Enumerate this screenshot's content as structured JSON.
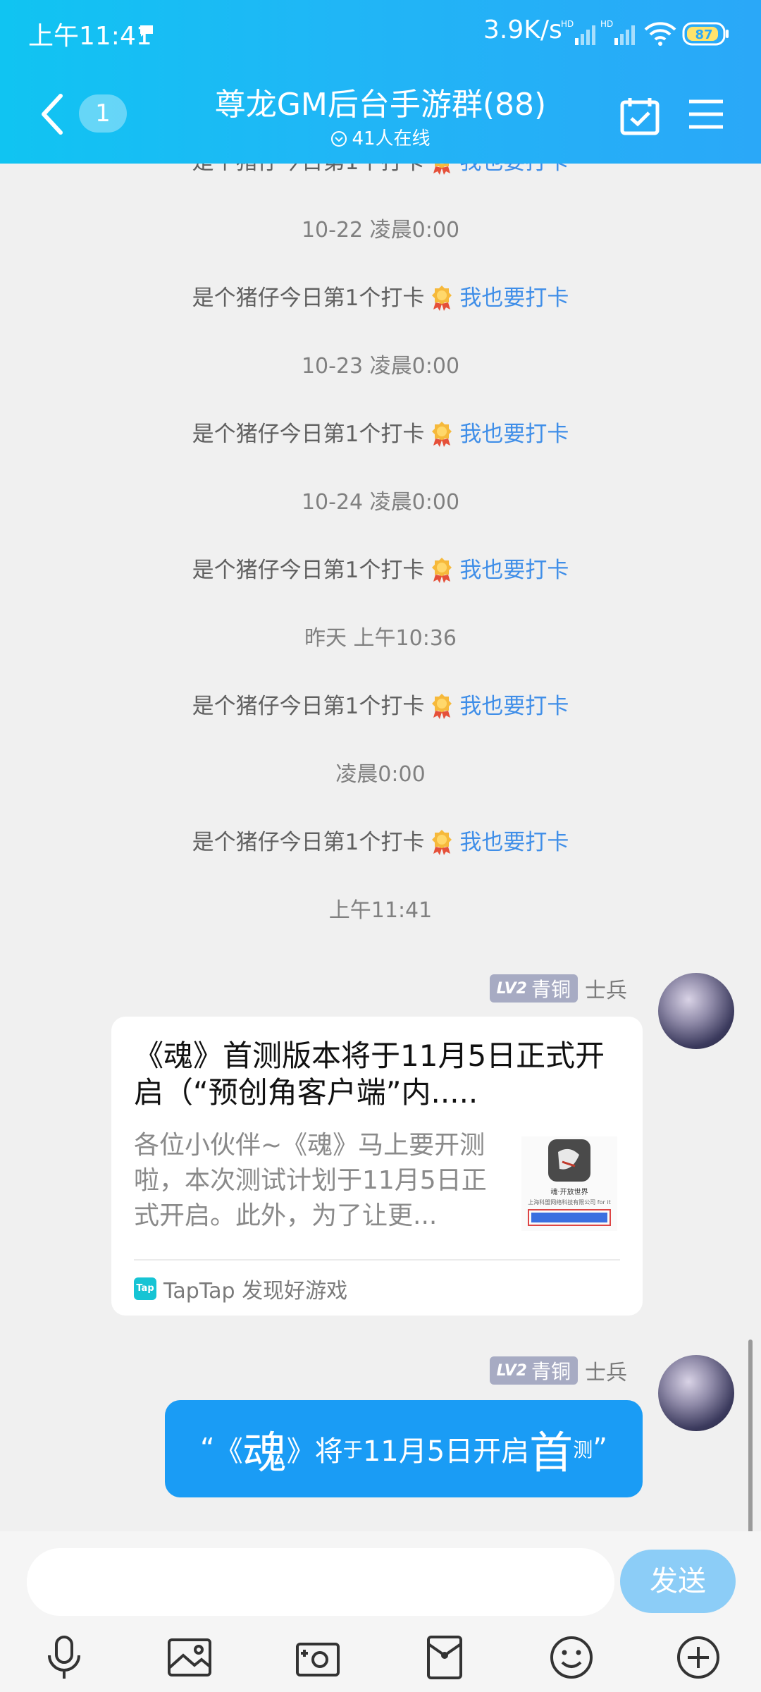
{
  "status_bar": {
    "time": "上午11:41",
    "net_speed": "3.9K/s",
    "signal_label": "HD",
    "battery": "87"
  },
  "header": {
    "unread_count": "1",
    "title": "尊龙GM后台手游群(88)",
    "online": "41人在线"
  },
  "checkin_text": "是个猪仔今日第1个打卡",
  "checkin_link": "我也要打卡",
  "timeline": [
    {
      "kind": "msg"
    },
    {
      "kind": "time",
      "text": "10-22 凌晨0:00"
    },
    {
      "kind": "msg"
    },
    {
      "kind": "time",
      "text": "10-23 凌晨0:00"
    },
    {
      "kind": "msg"
    },
    {
      "kind": "time",
      "text": "10-24 凌晨0:00"
    },
    {
      "kind": "msg"
    },
    {
      "kind": "time",
      "text": "昨天 上午10:36"
    },
    {
      "kind": "msg"
    },
    {
      "kind": "time",
      "text": "凌晨0:00"
    },
    {
      "kind": "msg"
    },
    {
      "kind": "time",
      "text": "上午11:41"
    }
  ],
  "sender": {
    "level": "LV2",
    "level_name": "青铜",
    "rank": "士兵"
  },
  "share_card": {
    "title": "《魂》首测版本将于11月5日正式开启（“预创角客户端”内.....",
    "description": "各位小伙伴~《魂》马上要开测啦，本次测试计划于11月5日正式开启。此外，为了让更...",
    "thumb_caption": "魂·开放世界",
    "thumb_sub": "上海科盟网络科技有限公司 for it",
    "source_icon": "Tap",
    "source": "TapTap 发现好游戏"
  },
  "message": {
    "open_quote": "“",
    "book_open": "《",
    "hun": "魂",
    "book_close": "》",
    "jiang": "将",
    "yu": "于",
    "date": "11月5日",
    "kaiqi": "开启",
    "shou": "首",
    "ce": "测",
    "close_quote": "”"
  },
  "input": {
    "placeholder": "",
    "send_label": "发送"
  },
  "toolbar": {
    "icons": [
      "microphone-icon",
      "image-icon",
      "camera-icon",
      "red-packet-icon",
      "emoji-icon",
      "plus-icon"
    ]
  },
  "colors": {
    "header_start": "#10c4f2",
    "header_end": "#2aa8f8",
    "link": "#3f8ee8",
    "bubble": "#1a9cf5",
    "send_button": "#8ccdf7"
  }
}
